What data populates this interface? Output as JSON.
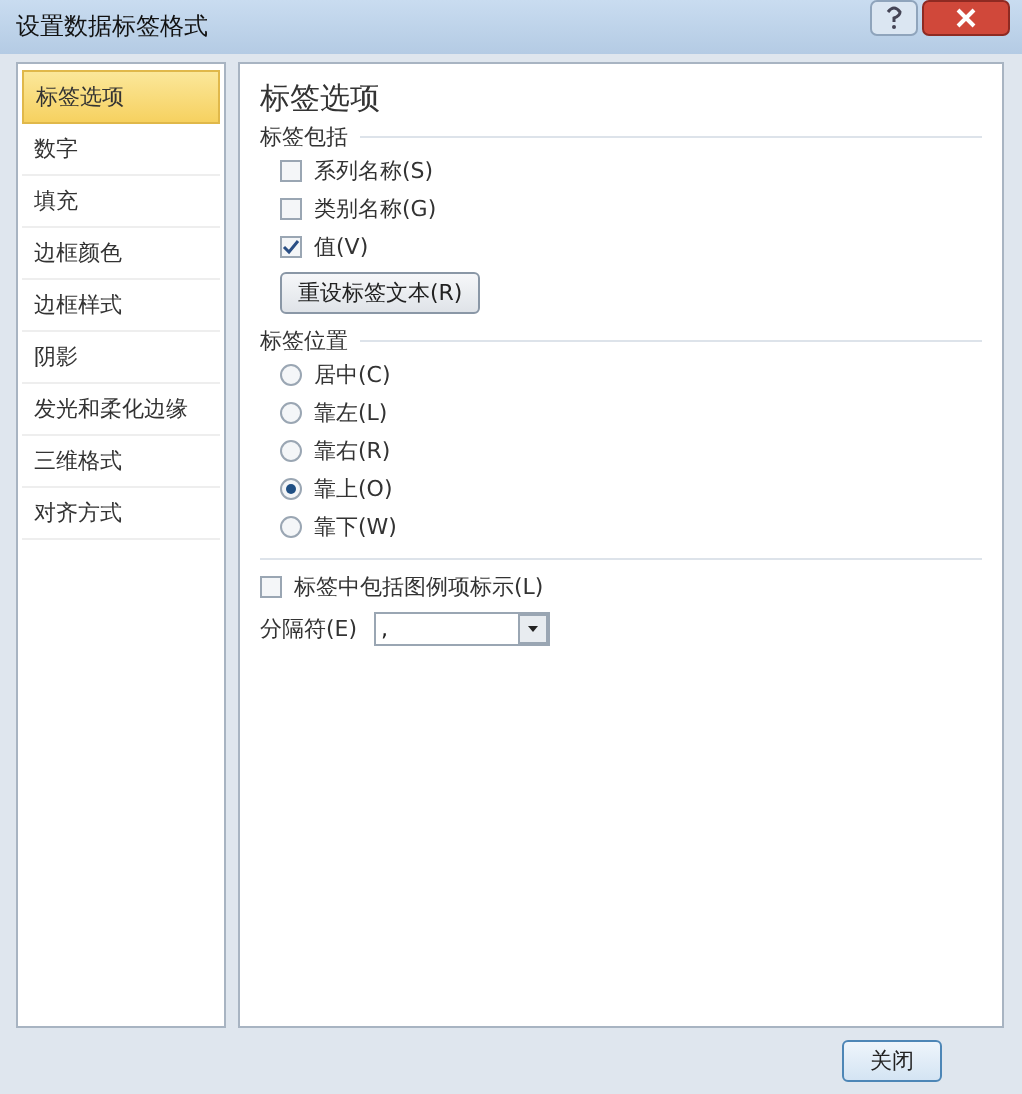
{
  "window": {
    "title": "设置数据标签格式"
  },
  "sidebar": {
    "items": [
      {
        "label": "标签选项",
        "selected": true
      },
      {
        "label": "数字",
        "selected": false
      },
      {
        "label": "填充",
        "selected": false
      },
      {
        "label": "边框颜色",
        "selected": false
      },
      {
        "label": "边框样式",
        "selected": false
      },
      {
        "label": "阴影",
        "selected": false
      },
      {
        "label": "发光和柔化边缘",
        "selected": false
      },
      {
        "label": "三维格式",
        "selected": false
      },
      {
        "label": "对齐方式",
        "selected": false
      }
    ]
  },
  "panel": {
    "title": "标签选项",
    "label_contains": {
      "heading": "标签包括",
      "options": [
        {
          "label": "系列名称(S)",
          "checked": false
        },
        {
          "label": "类别名称(G)",
          "checked": false
        },
        {
          "label": "值(V)",
          "checked": true
        }
      ],
      "reset_button": "重设标签文本(R)"
    },
    "label_position": {
      "heading": "标签位置",
      "options": [
        {
          "label": "居中(C)",
          "selected": false
        },
        {
          "label": "靠左(L)",
          "selected": false
        },
        {
          "label": "靠右(R)",
          "selected": false
        },
        {
          "label": "靠上(O)",
          "selected": true
        },
        {
          "label": "靠下(W)",
          "selected": false
        }
      ]
    },
    "legend_key": {
      "label": "标签中包括图例项标示(L)",
      "checked": false
    },
    "separator": {
      "label": "分隔符(E)",
      "value": ","
    }
  },
  "buttons": [
    "关闭"
  ]
}
